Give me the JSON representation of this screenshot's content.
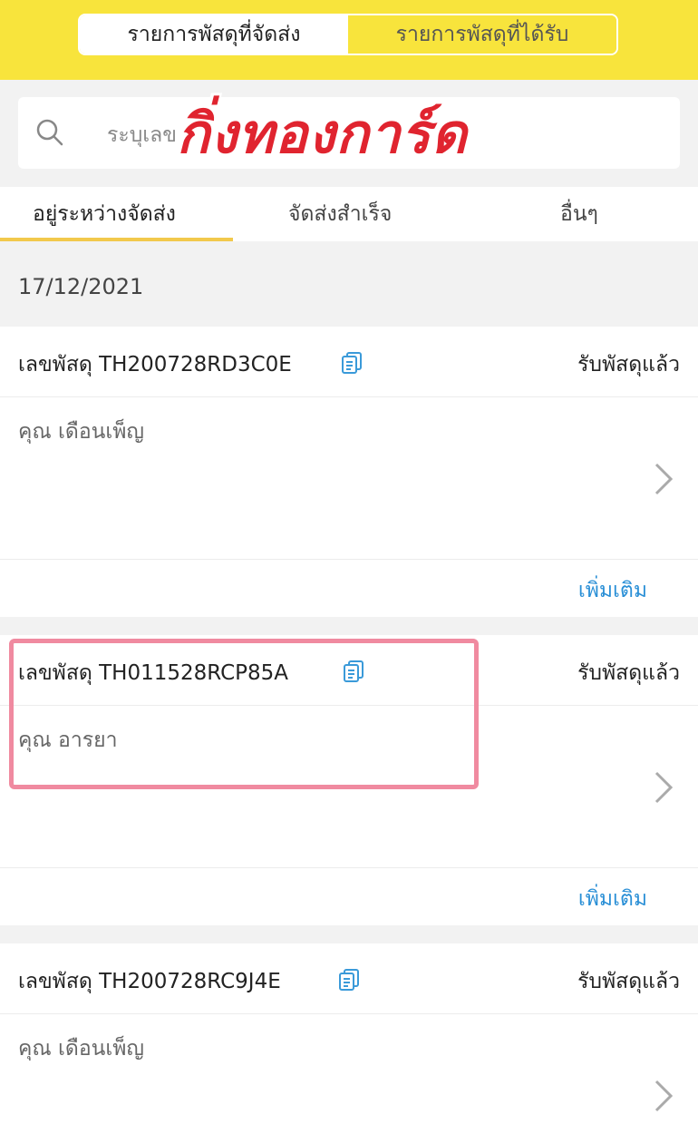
{
  "header": {
    "tabs": [
      {
        "label": "รายการพัสดุที่จัดส่ง",
        "active": true
      },
      {
        "label": "รายการพัสดุที่ได้รับ",
        "active": false
      }
    ]
  },
  "search": {
    "placeholder": "ระบุเลข"
  },
  "watermark": "กิ่งทองการ์ด",
  "filter_tabs": [
    {
      "label": "อยู่ระหว่างจัดส่ง",
      "active": true
    },
    {
      "label": "จัดส่งสำเร็จ",
      "active": false
    },
    {
      "label": "อื่นๆ",
      "active": false
    }
  ],
  "date": "17/12/2021",
  "parcels": [
    {
      "label": "เลขพัสดุ TH200728RD3C0E",
      "status": "รับพัสดุแล้ว",
      "recipient": "คุณ เดือนเพ็ญ",
      "more": "เพิ่มเติม"
    },
    {
      "label": "เลขพัสดุ TH011528RCP85A",
      "status": "รับพัสดุแล้ว",
      "recipient": "คุณ อารยา",
      "more": "เพิ่มเติม"
    },
    {
      "label": "เลขพัสดุ TH200728RC9J4E",
      "status": "รับพัสดุแล้ว",
      "recipient": "คุณ เดือนเพ็ญ",
      "more": ""
    }
  ],
  "colors": {
    "header_yellow": "#f8e43c",
    "link_blue": "#2a8fd6",
    "highlight_pink": "#f08aa0",
    "tab_underline": "#f2c94c"
  }
}
